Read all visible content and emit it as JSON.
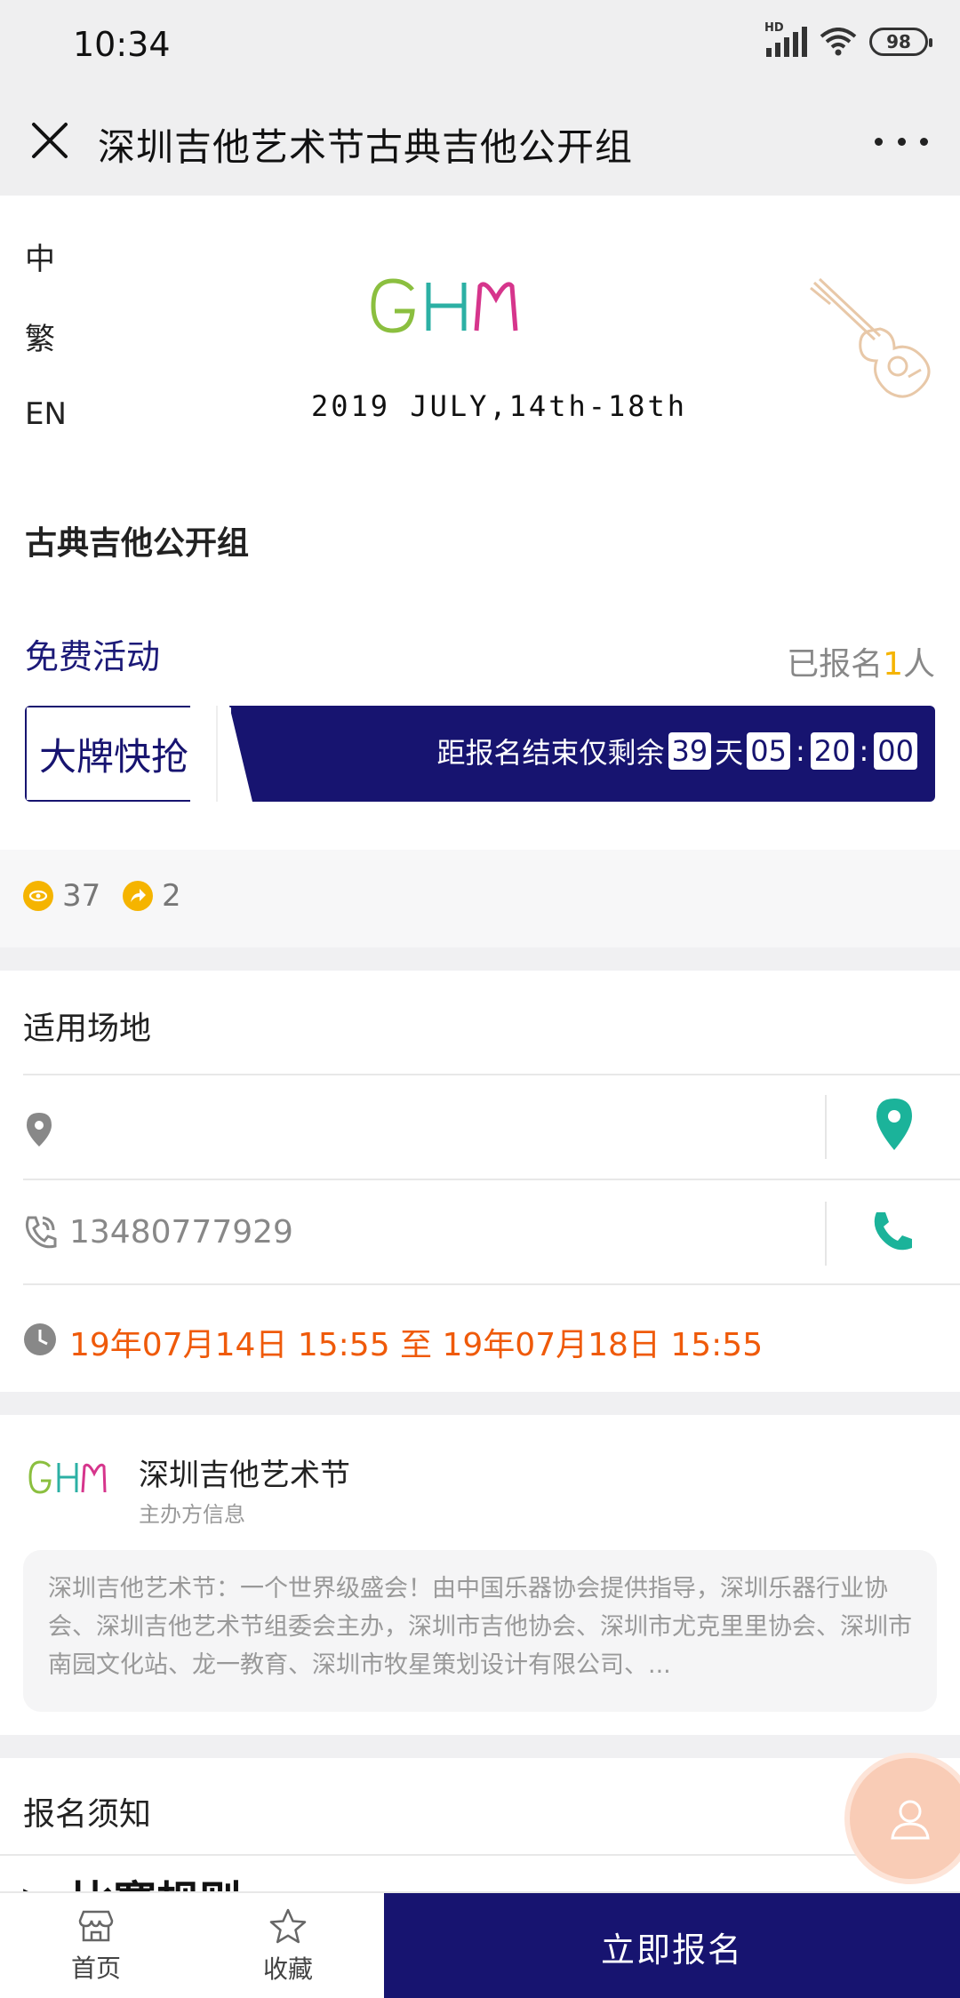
{
  "status_bar": {
    "time": "10:34",
    "network": "HD",
    "battery": "98"
  },
  "nav": {
    "title": "深圳吉他艺术节古典吉他公开组"
  },
  "languages": [
    "中",
    "繁",
    "EN"
  ],
  "banner": {
    "logo_text": "GHM",
    "date_text": "2019 JULY,14th-18th"
  },
  "event": {
    "title": "古典吉他公开组",
    "price_label": "免费活动",
    "signup_prefix": "已报名",
    "signup_count": "1",
    "signup_suffix": "人"
  },
  "promo": {
    "tag": "大牌快抢",
    "countdown_prefix": "距报名结束仅剩余",
    "days": "39",
    "days_unit": "天",
    "hours": "05",
    "minutes": "20",
    "seconds": "00"
  },
  "stats": {
    "views": "37",
    "shares": "2"
  },
  "venue": {
    "label": "适用场地",
    "address": "",
    "phone": "13480777929",
    "time_range": "19年07月14日 15:55 至 19年07月18日 15:55"
  },
  "organizer": {
    "name": "深圳吉他艺术节",
    "subtitle": "主办方信息",
    "description": "深圳吉他艺术节：一个世界级盛会！由中国乐器协会提供指导，深圳乐器行业协会、深圳吉他艺术节组委会主办，深圳市吉他协会、深圳市尤克里里协会、深圳市南园文化站、龙一教育、深圳市牧星策划设计有限公司、..."
  },
  "notice": {
    "label": "报名须知",
    "rules_peek": "▶ 比赛规则"
  },
  "bottom_bar": {
    "home": "首页",
    "favorite": "收藏",
    "signup_button": "立即报名"
  },
  "colors": {
    "primary": "#171470",
    "accent": "#f5b400",
    "date": "#ef5a0a",
    "teal": "#1bb39a"
  }
}
